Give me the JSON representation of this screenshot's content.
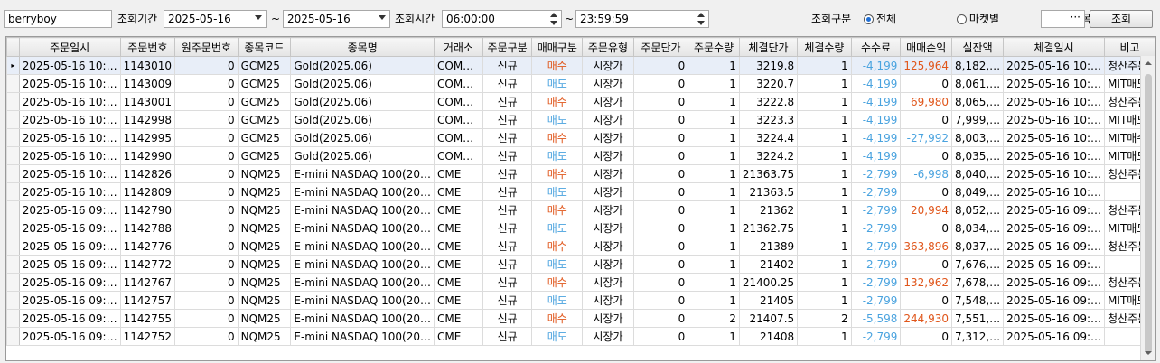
{
  "toolbar": {
    "user_id": "berryboy",
    "period_label": "조회기간",
    "date_from": "2025-05-16",
    "date_to": "2025-05-16",
    "tilde": "~",
    "time_label": "조회시간",
    "time_from": "06:00:00",
    "time_to": "23:59:59",
    "type_label": "조회구분",
    "radio_all": "전체",
    "radio_market": "마켓별",
    "radio_symbol": "종목별",
    "more_button": "···",
    "search_button": "조회"
  },
  "columns": [
    "주문일시",
    "주문번호",
    "원주문번호",
    "종목코드",
    "종목명",
    "거래소",
    "주문구분",
    "매매구분",
    "주문유형",
    "주문단가",
    "주문수량",
    "체결단가",
    "체결수량",
    "수수료",
    "매매손익",
    "실잔액",
    "체결일시",
    "비고"
  ],
  "rows": [
    [
      "2025-05-16 10:…",
      "1143010",
      "0",
      "GCM25",
      "Gold(2025.06)",
      "COM…",
      "신규",
      "매수",
      "시장가",
      "0",
      "1",
      "3219.8",
      "1",
      "-4,199",
      "125,964",
      "8,182,…",
      "2025-05-16 10:…",
      "청산주문"
    ],
    [
      "2025-05-16 10:…",
      "1143009",
      "0",
      "GCM25",
      "Gold(2025.06)",
      "COM…",
      "신규",
      "매도",
      "시장가",
      "0",
      "1",
      "3220.7",
      "1",
      "-4,199",
      "0",
      "8,061,…",
      "2025-05-16 10:…",
      "MIT매도"
    ],
    [
      "2025-05-16 10:…",
      "1143001",
      "0",
      "GCM25",
      "Gold(2025.06)",
      "COM…",
      "신규",
      "매수",
      "시장가",
      "0",
      "1",
      "3222.8",
      "1",
      "-4,199",
      "69,980",
      "8,065,…",
      "2025-05-16 10:…",
      "청산주문"
    ],
    [
      "2025-05-16 10:…",
      "1142998",
      "0",
      "GCM25",
      "Gold(2025.06)",
      "COM…",
      "신규",
      "매도",
      "시장가",
      "0",
      "1",
      "3223.3",
      "1",
      "-4,199",
      "0",
      "7,999,…",
      "2025-05-16 10:…",
      "MIT매도"
    ],
    [
      "2025-05-16 10:…",
      "1142995",
      "0",
      "GCM25",
      "Gold(2025.06)",
      "COM…",
      "신규",
      "매수",
      "시장가",
      "0",
      "1",
      "3224.4",
      "1",
      "-4,199",
      "-27,992",
      "8,003,…",
      "2025-05-16 10:…",
      "MIT매수"
    ],
    [
      "2025-05-16 10:…",
      "1142990",
      "0",
      "GCM25",
      "Gold(2025.06)",
      "COM…",
      "신규",
      "매도",
      "시장가",
      "0",
      "1",
      "3224.2",
      "1",
      "-4,199",
      "0",
      "8,035,…",
      "2025-05-16 10:…",
      "MIT매도"
    ],
    [
      "2025-05-16 10:…",
      "1142826",
      "0",
      "NQM25",
      "E-mini NASDAQ 100(20…",
      "CME",
      "신규",
      "매수",
      "시장가",
      "0",
      "1",
      "21363.75",
      "1",
      "-2,799",
      "-6,998",
      "8,040,…",
      "2025-05-16 10:…",
      "청산주문"
    ],
    [
      "2025-05-16 10:…",
      "1142809",
      "0",
      "NQM25",
      "E-mini NASDAQ 100(20…",
      "CME",
      "신규",
      "매도",
      "시장가",
      "0",
      "1",
      "21363.5",
      "1",
      "-2,799",
      "0",
      "8,049,…",
      "2025-05-16 10:…",
      ""
    ],
    [
      "2025-05-16 09:…",
      "1142790",
      "0",
      "NQM25",
      "E-mini NASDAQ 100(20…",
      "CME",
      "신규",
      "매수",
      "시장가",
      "0",
      "1",
      "21362",
      "1",
      "-2,799",
      "20,994",
      "8,052,…",
      "2025-05-16 09:…",
      "청산주문"
    ],
    [
      "2025-05-16 09:…",
      "1142788",
      "0",
      "NQM25",
      "E-mini NASDAQ 100(20…",
      "CME",
      "신규",
      "매도",
      "시장가",
      "0",
      "1",
      "21362.75",
      "1",
      "-2,799",
      "0",
      "8,034,…",
      "2025-05-16 09:…",
      "MIT매도"
    ],
    [
      "2025-05-16 09:…",
      "1142776",
      "0",
      "NQM25",
      "E-mini NASDAQ 100(20…",
      "CME",
      "신규",
      "매수",
      "시장가",
      "0",
      "1",
      "21389",
      "1",
      "-2,799",
      "363,896",
      "8,037,…",
      "2025-05-16 09:…",
      "청산주문"
    ],
    [
      "2025-05-16 09:…",
      "1142772",
      "0",
      "NQM25",
      "E-mini NASDAQ 100(20…",
      "CME",
      "신규",
      "매도",
      "시장가",
      "0",
      "1",
      "21402",
      "1",
      "-2,799",
      "0",
      "7,676,…",
      "2025-05-16 09:…",
      ""
    ],
    [
      "2025-05-16 09:…",
      "1142767",
      "0",
      "NQM25",
      "E-mini NASDAQ 100(20…",
      "CME",
      "신규",
      "매수",
      "시장가",
      "0",
      "1",
      "21400.25",
      "1",
      "-2,799",
      "132,962",
      "7,678,…",
      "2025-05-16 09:…",
      "청산주문"
    ],
    [
      "2025-05-16 09:…",
      "1142757",
      "0",
      "NQM25",
      "E-mini NASDAQ 100(20…",
      "CME",
      "신규",
      "매도",
      "시장가",
      "0",
      "1",
      "21405",
      "1",
      "-2,799",
      "0",
      "7,548,…",
      "2025-05-16 09:…",
      "MIT매도"
    ],
    [
      "2025-05-16 09:…",
      "1142755",
      "0",
      "NQM25",
      "E-mini NASDAQ 100(20…",
      "CME",
      "신규",
      "매수",
      "시장가",
      "0",
      "2",
      "21407.5",
      "2",
      "-5,598",
      "244,930",
      "7,551,…",
      "2025-05-16 09:…",
      "청산주문"
    ],
    [
      "2025-05-16 09:…",
      "1142752",
      "0",
      "NQM25",
      "E-mini NASDAQ 100(20…",
      "CME",
      "신규",
      "매도",
      "시장가",
      "0",
      "1",
      "21408",
      "1",
      "-2,799",
      "0",
      "7,312,…",
      "2025-05-16 09:…",
      ""
    ]
  ],
  "selected_row_marker": "▸",
  "colors": {
    "buy": "#e0561b",
    "sell": "#4aa3df",
    "profit": "#e0561b",
    "loss": "#4aa3df"
  }
}
